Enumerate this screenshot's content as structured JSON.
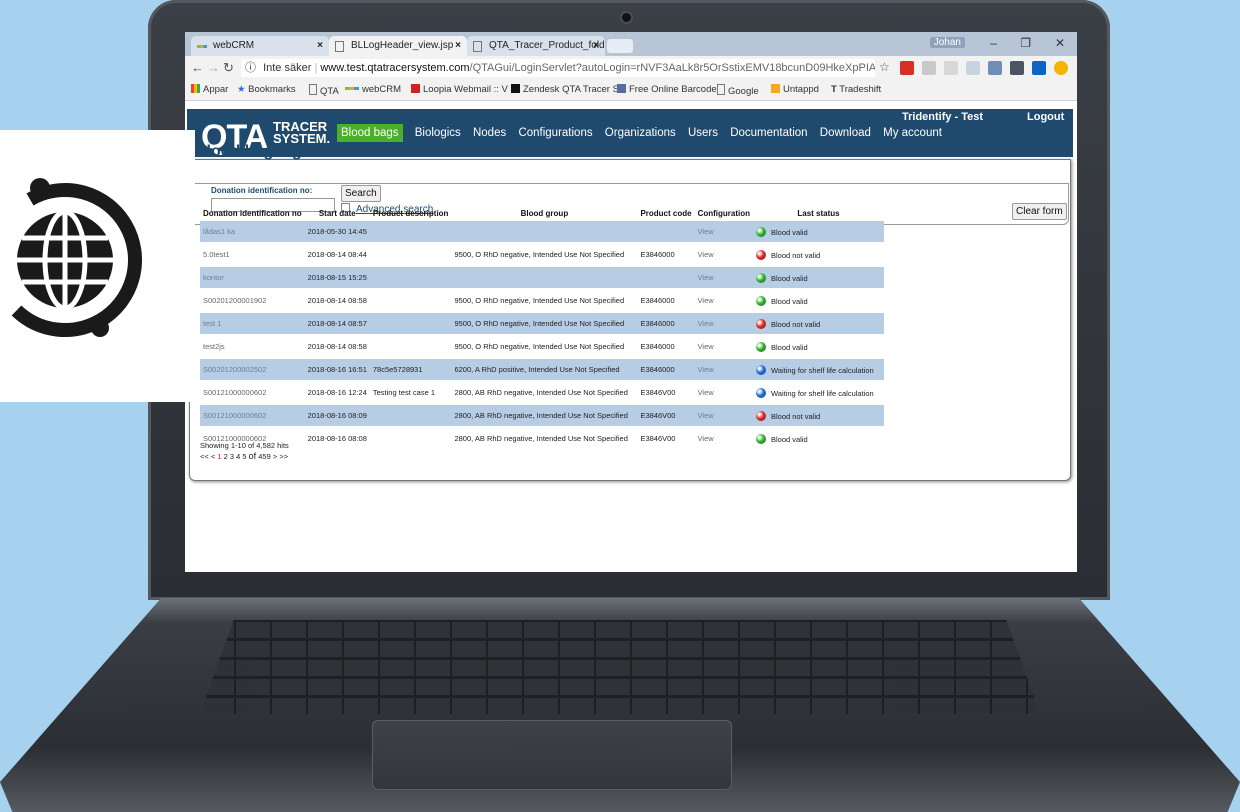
{
  "browser": {
    "tabs": [
      {
        "label": "webCRM"
      },
      {
        "label": "BLLogHeader_view.jsp"
      },
      {
        "label": "QTA_Tracer_Product_fold"
      }
    ],
    "user": "Johan",
    "url": {
      "security": "Inte säker",
      "host": "www.test.qtatracersystem.com",
      "path": "/QTAGui/LoginServlet?autoLogin=rNVF3AaLk8r5OrSstixEMV18bcunD09HkeXpPIAXeSNFg3..."
    },
    "bookmarks": [
      "Appar",
      "Bookmarks",
      "QTA",
      "webCRM",
      "Loopia Webmail :: V",
      "Zendesk QTA Tracer S",
      "Free Online Barcode",
      "Google",
      "Untappd",
      "Tradeshift"
    ],
    "colors": {
      "tabstrip": "#b7c5d6",
      "chrome": "#f2f2f2"
    }
  },
  "app": {
    "logo": {
      "main": "QTA",
      "line1": "TRACER",
      "line2": "SYSTEM."
    },
    "menu": [
      "Blood bags",
      "Biologics",
      "Nodes",
      "Configurations",
      "Organizations",
      "Users",
      "Documentation",
      "Download",
      "My account"
    ],
    "tenant": "Tridentify - Test",
    "logout": "Logout",
    "colors": {
      "header": "#1f4a6e",
      "active_menu": "#4caf2a",
      "row_alt": "#b7cde6"
    }
  },
  "page": {
    "title": "Blood bag logs",
    "search": {
      "label": "Donation identification no:",
      "value": "",
      "button": "Search",
      "advanced": "Advanced search",
      "clear": "Clear form"
    },
    "table": {
      "columns": [
        "Donation identification no",
        "Start date",
        "Product description",
        "Blood group",
        "Product code",
        "Configuration",
        "Last status"
      ],
      "rows": [
        {
          "id": "lådas1 ka",
          "start": "2018-05-30 14:45",
          "desc": "",
          "group": "",
          "code": "",
          "config": "View",
          "status": "Blood valid",
          "status_color": "green"
        },
        {
          "id": "5.0test1",
          "start": "2018-08-14 08:44",
          "desc": "",
          "group": "9500, O RhD negative, Intended Use Not Specified",
          "code": "E3846000",
          "config": "View",
          "status": "Blood not valid",
          "status_color": "red"
        },
        {
          "id": "kontor",
          "start": "2018-08-15 15:25",
          "desc": "",
          "group": "",
          "code": "",
          "config": "View",
          "status": "Blood valid",
          "status_color": "green"
        },
        {
          "id": "S00201200001902",
          "start": "2018-08-14 08:58",
          "desc": "",
          "group": "9500, O RhD negative, Intended Use Not Specified",
          "code": "E3846000",
          "config": "View",
          "status": "Blood valid",
          "status_color": "green"
        },
        {
          "id": "test 1",
          "start": "2018-08-14 08:57",
          "desc": "",
          "group": "9500, O RhD negative, Intended Use Not Specified",
          "code": "E3846000",
          "config": "View",
          "status": "Blood not valid",
          "status_color": "red"
        },
        {
          "id": "test2js",
          "start": "2018-08-14 08:58",
          "desc": "",
          "group": "9500, O RhD negative, Intended Use Not Specified",
          "code": "E3846000",
          "config": "View",
          "status": "Blood valid",
          "status_color": "green"
        },
        {
          "id": "S00201200002502",
          "start": "2018-08-16 16:51",
          "desc": "78c5e5728931",
          "group": "6200, A RhD positive, Intended Use Not Specified",
          "code": "E3846000",
          "config": "View",
          "status": "Waiting for shelf life calculation",
          "status_color": "blue"
        },
        {
          "id": "S00121000000602",
          "start": "2018-08-16 12:24",
          "desc": "Testing test case 1",
          "group": "2800, AB RhD negative, Intended Use Not Specified",
          "code": "E3846V00",
          "config": "View",
          "status": "Waiting for shelf life calculation",
          "status_color": "blue"
        },
        {
          "id": "S00121000000602",
          "start": "2018-08-16 08:09",
          "desc": "",
          "group": "2800, AB RhD negative, Intended Use Not Specified",
          "code": "E3846V00",
          "config": "View",
          "status": "Blood not valid",
          "status_color": "red"
        },
        {
          "id": "S00121000000602",
          "start": "2018-08-16 08:08",
          "desc": "",
          "group": "2800, AB RhD negative, Intended Use Not Specified",
          "code": "E3846V00",
          "config": "View",
          "status": "Blood valid",
          "status_color": "green"
        }
      ]
    },
    "pager": {
      "summary": "Showing 1-10 of 4,582 hits",
      "prev": "<< <",
      "pages": [
        "1",
        "2",
        "3",
        "4",
        "5"
      ],
      "of": "of",
      "total": "459",
      "next": "> >>"
    }
  },
  "status_colors": {
    "green": "#2fb52a",
    "red": "#e02424",
    "blue": "#1e6fe0"
  }
}
